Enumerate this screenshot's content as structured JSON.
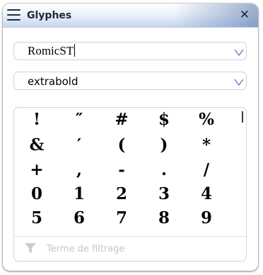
{
  "window": {
    "title": "Glyphes",
    "close_symbol": "✕",
    "accent_color": "#4e6fa8"
  },
  "font_select": {
    "value": "RomicST"
  },
  "style_select": {
    "value": "extrabold"
  },
  "glyphs": [
    "!",
    "″",
    "#",
    "$",
    "%",
    "&",
    "′",
    "(",
    ")",
    "*",
    "+",
    ",",
    "-",
    ".",
    "/",
    "0",
    "1",
    "2",
    "3",
    "4",
    "5",
    "6",
    "7",
    "8",
    "9"
  ],
  "filter": {
    "placeholder": "Terme de filtrage",
    "value": ""
  },
  "icons": {
    "menu": "hamburger-menu-icon",
    "close": "close-icon",
    "dropdown": "chevron-down-icon",
    "filter": "funnel-filter-icon"
  }
}
